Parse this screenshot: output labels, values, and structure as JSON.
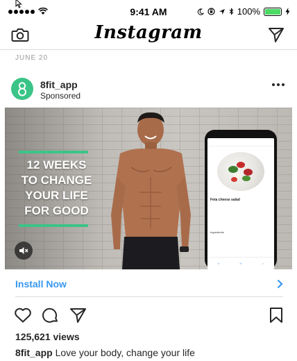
{
  "status_bar": {
    "time": "9:41 AM",
    "battery": "100%",
    "battery_level": 1.0,
    "signal_bars": 5,
    "icons": [
      "wifi-icon",
      "moon-icon",
      "lock-rotation-icon",
      "location-icon",
      "bluetooth-icon",
      "charging-icon"
    ]
  },
  "nav": {
    "logo": "Instagram",
    "left_icon": "camera-icon",
    "right_icon": "direct-message-icon"
  },
  "feed": {
    "date": "JUNE 20"
  },
  "post": {
    "username": "8fit_app",
    "sponsored": "Sponsored",
    "avatar_icon": "8fit-logo",
    "headline_lines": [
      "12 WEEKS",
      "TO CHANGE",
      "YOUR LIFE",
      "FOR GOOD"
    ],
    "phone_screen": {
      "title": "Feta cheese salad",
      "section": "Ingredients"
    },
    "cta": "Install Now",
    "views": "125,621 views",
    "caption_user": "8fit_app",
    "caption_text": "Love your body, change your life"
  },
  "colors": {
    "accent": "#3897f0",
    "brand_green": "#3bc487",
    "text": "#262626",
    "muted": "#999999"
  }
}
